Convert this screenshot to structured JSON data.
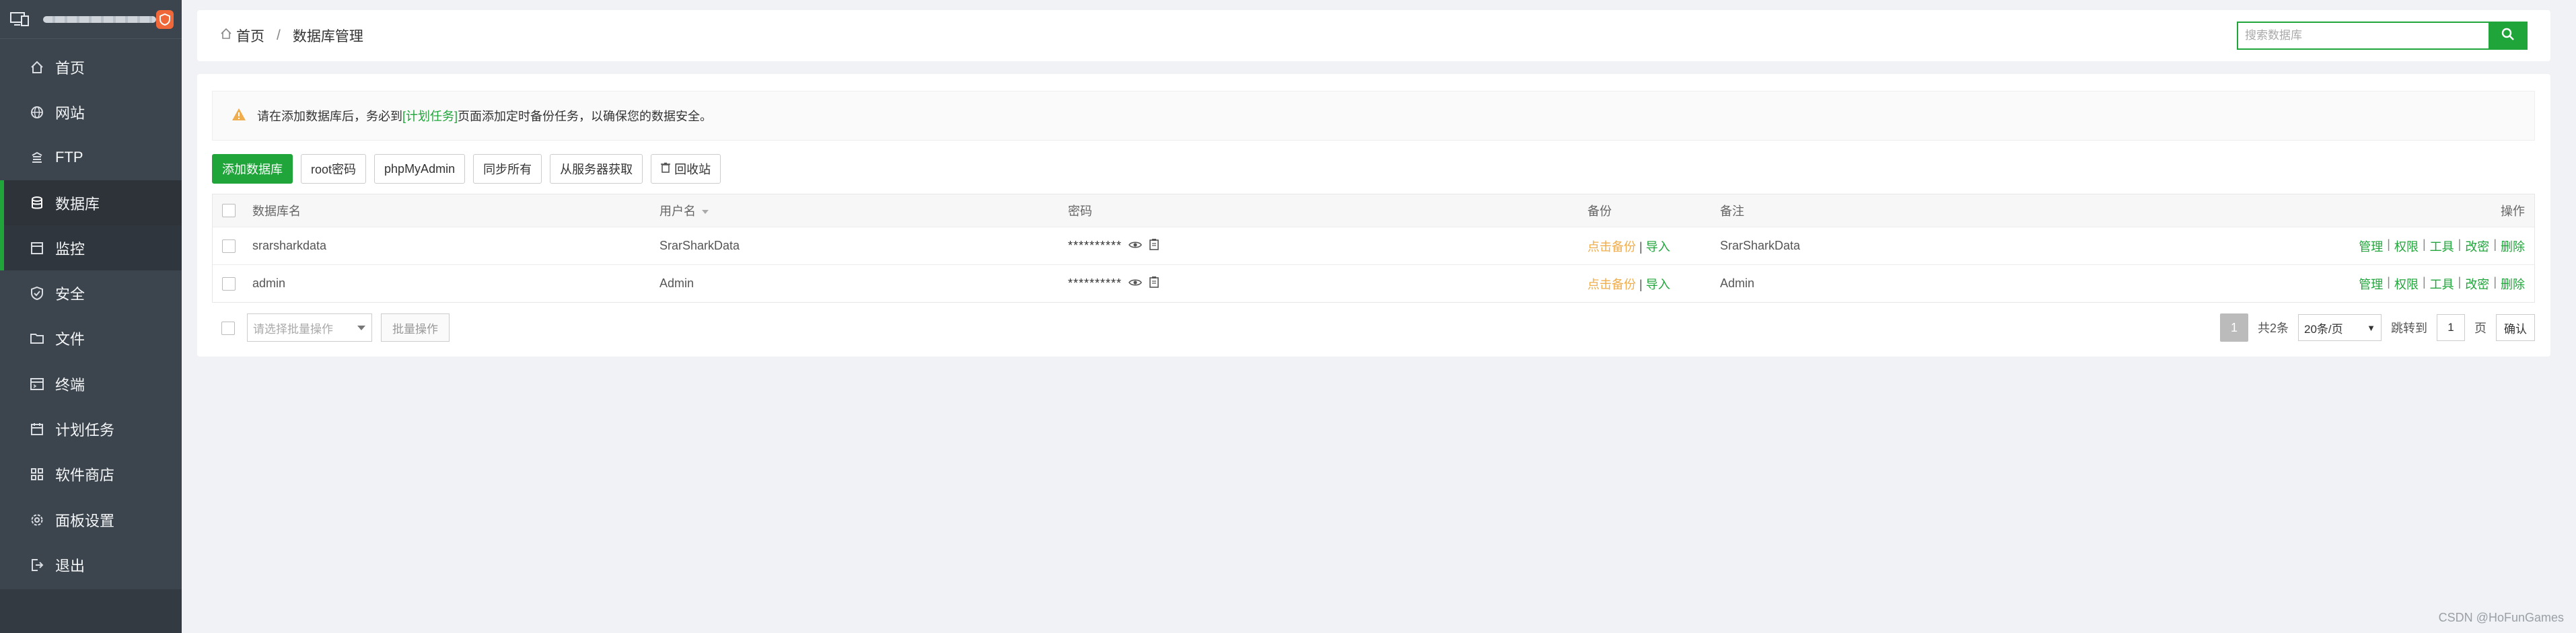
{
  "colors": {
    "accent": "#20a53a",
    "sidebar": "#3c444d",
    "warning": "#f0ad4e",
    "badge": "#f0683a"
  },
  "brand": {
    "badge_icon": "shield-icon"
  },
  "sidebar": {
    "items": [
      {
        "label": "首页",
        "icon": "home-icon"
      },
      {
        "label": "网站",
        "icon": "globe-icon"
      },
      {
        "label": "FTP",
        "icon": "ftp-icon"
      },
      {
        "label": "数据库",
        "icon": "database-icon",
        "active": true
      },
      {
        "label": "监控",
        "icon": "monitor-icon"
      },
      {
        "label": "安全",
        "icon": "shield-check-icon"
      },
      {
        "label": "文件",
        "icon": "folder-icon"
      },
      {
        "label": "终端",
        "icon": "terminal-icon"
      },
      {
        "label": "计划任务",
        "icon": "calendar-icon"
      },
      {
        "label": "软件商店",
        "icon": "grid-icon"
      },
      {
        "label": "面板设置",
        "icon": "gear-icon"
      },
      {
        "label": "退出",
        "icon": "logout-icon"
      }
    ]
  },
  "header": {
    "breadcrumb_home": "首页",
    "breadcrumb_sep": "/",
    "breadcrumb_current": "数据库管理",
    "search_placeholder": "搜索数据库"
  },
  "notice": {
    "before": "请在添加数据库后，务必到",
    "link": "[计划任务]",
    "after": "页面添加定时备份任务，以确保您的数据安全。"
  },
  "toolbar": {
    "add_db": "添加数据库",
    "root_pwd": "root密码",
    "phpmyadmin": "phpMyAdmin",
    "sync_all": "同步所有",
    "from_server": "从服务器获取",
    "recycle_bin": "回收站"
  },
  "table": {
    "headers": {
      "name": "数据库名",
      "user": "用户名",
      "password": "密码",
      "backup": "备份",
      "note": "备注",
      "ops": "操作"
    },
    "rows": [
      {
        "name": "srarsharkdata",
        "user": "SrarSharkData",
        "password": "**********",
        "backup": "点击备份",
        "backup_sep": "|",
        "import": "导入",
        "note": "SrarSharkData"
      },
      {
        "name": "admin",
        "user": "Admin",
        "password": "**********",
        "backup": "点击备份",
        "backup_sep": "|",
        "import": "导入",
        "note": "Admin"
      }
    ],
    "ops": {
      "manage": "管理",
      "perm": "权限",
      "tools": "工具",
      "change_pwd": "改密",
      "delete": "删除",
      "sep": "|"
    }
  },
  "bottom": {
    "batch_placeholder": "请选择批量操作",
    "batch_button": "批量操作"
  },
  "pager": {
    "current_page": "1",
    "total": "共2条",
    "page_size": "20条/页",
    "jump_label": "跳转到",
    "jump_value": "1",
    "page_unit": "页",
    "confirm": "确认"
  },
  "watermark": "CSDN @HoFunGames"
}
